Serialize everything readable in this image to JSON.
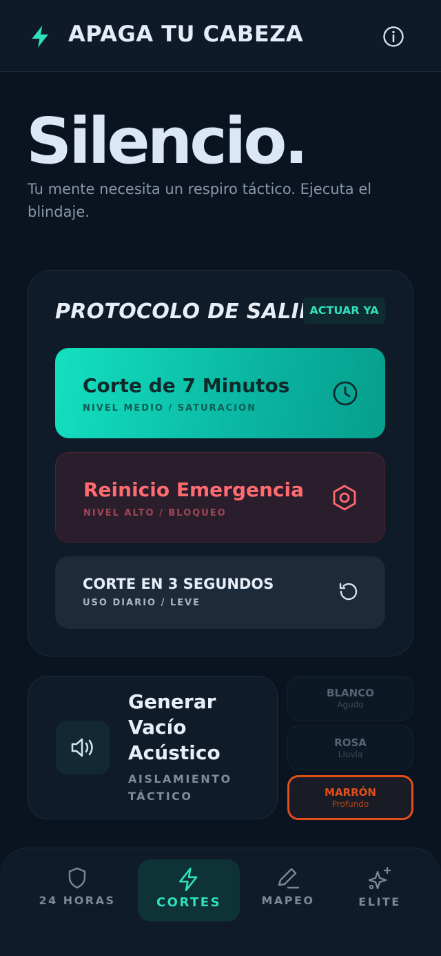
{
  "header": {
    "title": "APAGA TU CABEZA",
    "logo_icon": "bolt-icon",
    "info_icon": "info-icon"
  },
  "hero": {
    "title": "Silencio.",
    "subtitle": "Tu mente necesita un respiro táctico. Ejecuta el blindaje."
  },
  "protocol": {
    "title": "PROTOCOLO DE SALIDA",
    "badge": "ACTUAR YA",
    "options": [
      {
        "title": "Corte de 7 Minutos",
        "subtitle": "NIVEL MEDIO / SATURACIÓN",
        "icon": "clock-icon"
      },
      {
        "title": "Reinicio Emergencia",
        "subtitle": "NIVEL ALTO / BLOQUEO",
        "icon": "hexagon-icon"
      },
      {
        "title": "CORTE EN 3 SEGUNDOS",
        "subtitle": "USO DIARIO / LEVE",
        "icon": "rotate-icon"
      }
    ]
  },
  "sound": {
    "title": "Generar Vacío Acústico",
    "subtitle": "AISLAMIENTO TÁCTICO",
    "icon": "speaker-icon",
    "noises": [
      {
        "name": "BLANCO",
        "desc": "Agudo"
      },
      {
        "name": "ROSA",
        "desc": "Lluvia"
      },
      {
        "name": "MARRÓN",
        "desc": "Profundo",
        "selected": true
      }
    ]
  },
  "nav": {
    "items": [
      {
        "label": "24 HORAS",
        "icon": "shield-icon"
      },
      {
        "label": "CORTES",
        "icon": "bolt-icon",
        "active": true
      },
      {
        "label": "MAPEO",
        "icon": "pencil-icon"
      },
      {
        "label": "ELITE",
        "icon": "sparkles-icon"
      }
    ]
  },
  "colors": {
    "accent": "#2fe0bd",
    "danger": "#ff6b70",
    "selected_noise": "#e24e1b",
    "background": "#0a1421"
  }
}
